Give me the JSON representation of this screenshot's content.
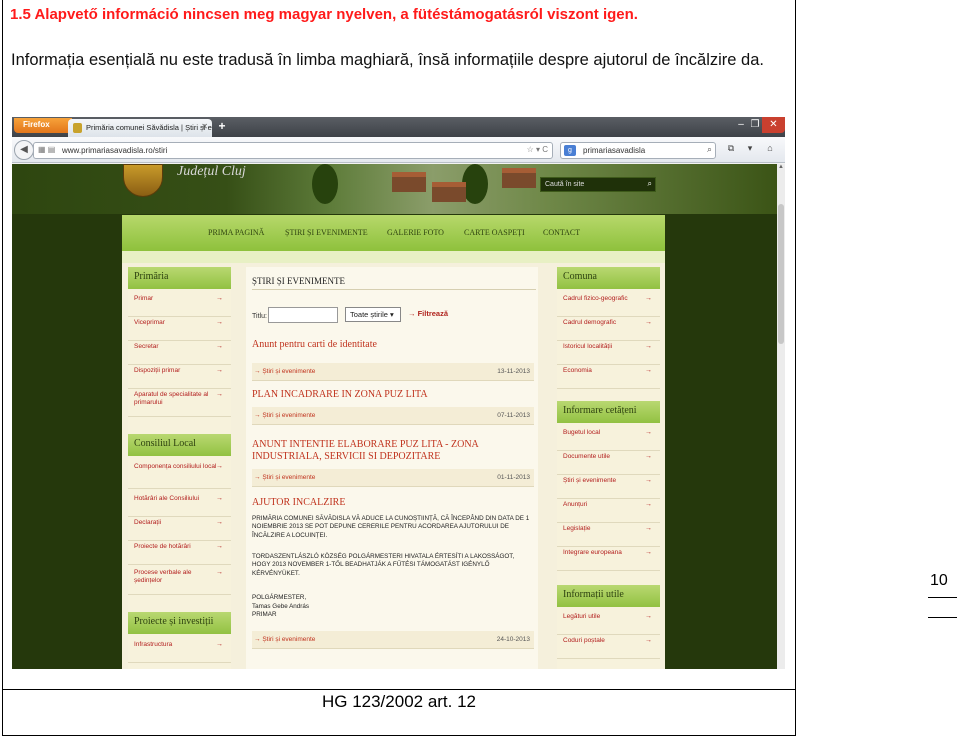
{
  "document": {
    "heading": "1.5 Alapvető információ nincsen meg magyar nyelven, a fütéstámogatásról viszont igen.",
    "paragraph": "Informația esențială nu este tradusă în limba maghiară, însă informațiile despre ajutorul de încălzire da.",
    "footer": "HG 123/2002 art. 12",
    "page_number": "10"
  },
  "browser": {
    "app_button": "Firefox",
    "tab_title": "Primăria comunei Săvădisla | Știri și even...",
    "new_tab": "+",
    "url": "www.primariasavadisla.ro/stiri",
    "search_value": "primariasavadisla"
  },
  "site": {
    "county_label": "Județul Cluj",
    "search_placeholder": "Caută în site",
    "menu": [
      "PRIMA PAGINĂ",
      "ȘTIRI ȘI EVENIMENTE",
      "GALERIE FOTO",
      "CARTE OASPEȚI",
      "CONTACT"
    ],
    "left_sections": [
      {
        "title": "Primăria",
        "items": [
          "Primar",
          "Viceprimar",
          "Secretar",
          "Dispoziții primar",
          "Aparatul de specialitate al primarului"
        ]
      },
      {
        "title": "Consiliul Local",
        "items": [
          "Componența consiliului local",
          "Hotărâri ale Consiliului",
          "Declarații",
          "Proiecte de hotărâri",
          "Procese verbale ale ședințelor"
        ]
      },
      {
        "title": "Proiecte și investiții",
        "items": [
          "Infrastructura"
        ]
      }
    ],
    "right_sections": [
      {
        "title": "Comuna",
        "items": [
          "Cadrul fizico-geografic",
          "Cadrul demografic",
          "Istoricul localității",
          "Economia"
        ]
      },
      {
        "title": "Informare cetățeni",
        "items": [
          "Bugetul local",
          "Documente utile",
          "Știri și evenimente",
          "Anunțuri",
          "Legislație",
          "Integrare europeana"
        ]
      },
      {
        "title": "Informații utile",
        "items": [
          "Legături utile",
          "Coduri poștale"
        ]
      }
    ],
    "content": {
      "title": "ȘTIRI ȘI EVENIMENTE",
      "filter_label": "Titlu:",
      "filter_select": "Toate știrile",
      "filter_button": "Filtrează",
      "category": "Știri și evenimente",
      "news": [
        {
          "title": "Anunt pentru carti de identitate",
          "date": "13-11-2013"
        },
        {
          "title": "PLAN INCADRARE IN ZONA PUZ LITA",
          "date": "07-11-2013"
        },
        {
          "title": "ANUNT INTENTIE ELABORARE PUZ LITA - ZONA INDUSTRIALA, SERVICII SI DEPOZITARE",
          "date": "01-11-2013"
        },
        {
          "title": "AJUTOR INCALZIRE",
          "body_ro": "PRIMĂRIA COMUNEI SĂVĂDISLA VĂ ADUCE LA CUNOȘTIINȚĂ, CĂ ÎNCEPÂND DIN DATA DE 1 NOIEMBRIE 2013 SE POT DEPUNE CERERILE PENTRU ACORDAREA AJUTORULUI DE ÎNCĂLZIRE A LOCUINȚEI.",
          "body_hu": "TORDASZENTLÁSZLÓ KÖZSÉG POLGÁRMESTERI HIVATALA ÉRTESÍTI A LAKOSSÁGOT, HOGY 2013 NOVEMBER 1-TŐL BEADHATJÁK A FŰTÉSI TÁMOGATÁST IGÉNYLŐ KÉRVÉNYÜKET.",
          "sign1": "POLGÁRMESTER,",
          "sign2": "Tamas Gebe András",
          "sign3": "PRIMAR",
          "date": "24-10-2013"
        }
      ]
    }
  }
}
